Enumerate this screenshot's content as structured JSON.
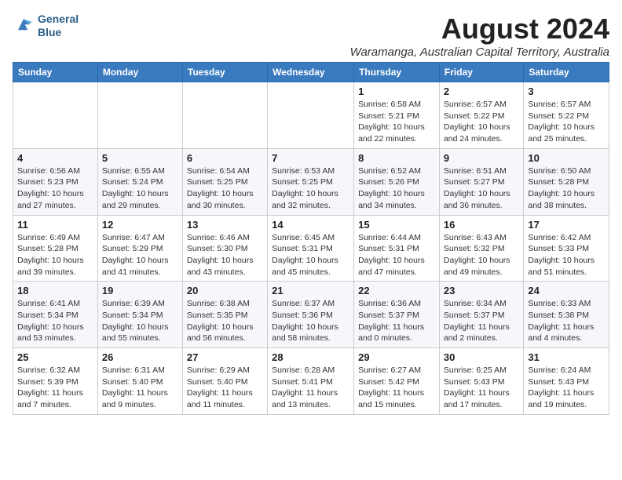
{
  "logo": {
    "line1": "General",
    "line2": "Blue"
  },
  "title": "August 2024",
  "subtitle": "Waramanga, Australian Capital Territory, Australia",
  "header_days": [
    "Sunday",
    "Monday",
    "Tuesday",
    "Wednesday",
    "Thursday",
    "Friday",
    "Saturday"
  ],
  "weeks": [
    [
      {
        "day": "",
        "info": ""
      },
      {
        "day": "",
        "info": ""
      },
      {
        "day": "",
        "info": ""
      },
      {
        "day": "",
        "info": ""
      },
      {
        "day": "1",
        "info": "Sunrise: 6:58 AM\nSunset: 5:21 PM\nDaylight: 10 hours\nand 22 minutes."
      },
      {
        "day": "2",
        "info": "Sunrise: 6:57 AM\nSunset: 5:22 PM\nDaylight: 10 hours\nand 24 minutes."
      },
      {
        "day": "3",
        "info": "Sunrise: 6:57 AM\nSunset: 5:22 PM\nDaylight: 10 hours\nand 25 minutes."
      }
    ],
    [
      {
        "day": "4",
        "info": "Sunrise: 6:56 AM\nSunset: 5:23 PM\nDaylight: 10 hours\nand 27 minutes."
      },
      {
        "day": "5",
        "info": "Sunrise: 6:55 AM\nSunset: 5:24 PM\nDaylight: 10 hours\nand 29 minutes."
      },
      {
        "day": "6",
        "info": "Sunrise: 6:54 AM\nSunset: 5:25 PM\nDaylight: 10 hours\nand 30 minutes."
      },
      {
        "day": "7",
        "info": "Sunrise: 6:53 AM\nSunset: 5:25 PM\nDaylight: 10 hours\nand 32 minutes."
      },
      {
        "day": "8",
        "info": "Sunrise: 6:52 AM\nSunset: 5:26 PM\nDaylight: 10 hours\nand 34 minutes."
      },
      {
        "day": "9",
        "info": "Sunrise: 6:51 AM\nSunset: 5:27 PM\nDaylight: 10 hours\nand 36 minutes."
      },
      {
        "day": "10",
        "info": "Sunrise: 6:50 AM\nSunset: 5:28 PM\nDaylight: 10 hours\nand 38 minutes."
      }
    ],
    [
      {
        "day": "11",
        "info": "Sunrise: 6:49 AM\nSunset: 5:28 PM\nDaylight: 10 hours\nand 39 minutes."
      },
      {
        "day": "12",
        "info": "Sunrise: 6:47 AM\nSunset: 5:29 PM\nDaylight: 10 hours\nand 41 minutes."
      },
      {
        "day": "13",
        "info": "Sunrise: 6:46 AM\nSunset: 5:30 PM\nDaylight: 10 hours\nand 43 minutes."
      },
      {
        "day": "14",
        "info": "Sunrise: 6:45 AM\nSunset: 5:31 PM\nDaylight: 10 hours\nand 45 minutes."
      },
      {
        "day": "15",
        "info": "Sunrise: 6:44 AM\nSunset: 5:31 PM\nDaylight: 10 hours\nand 47 minutes."
      },
      {
        "day": "16",
        "info": "Sunrise: 6:43 AM\nSunset: 5:32 PM\nDaylight: 10 hours\nand 49 minutes."
      },
      {
        "day": "17",
        "info": "Sunrise: 6:42 AM\nSunset: 5:33 PM\nDaylight: 10 hours\nand 51 minutes."
      }
    ],
    [
      {
        "day": "18",
        "info": "Sunrise: 6:41 AM\nSunset: 5:34 PM\nDaylight: 10 hours\nand 53 minutes."
      },
      {
        "day": "19",
        "info": "Sunrise: 6:39 AM\nSunset: 5:34 PM\nDaylight: 10 hours\nand 55 minutes."
      },
      {
        "day": "20",
        "info": "Sunrise: 6:38 AM\nSunset: 5:35 PM\nDaylight: 10 hours\nand 56 minutes."
      },
      {
        "day": "21",
        "info": "Sunrise: 6:37 AM\nSunset: 5:36 PM\nDaylight: 10 hours\nand 58 minutes."
      },
      {
        "day": "22",
        "info": "Sunrise: 6:36 AM\nSunset: 5:37 PM\nDaylight: 11 hours\nand 0 minutes."
      },
      {
        "day": "23",
        "info": "Sunrise: 6:34 AM\nSunset: 5:37 PM\nDaylight: 11 hours\nand 2 minutes."
      },
      {
        "day": "24",
        "info": "Sunrise: 6:33 AM\nSunset: 5:38 PM\nDaylight: 11 hours\nand 4 minutes."
      }
    ],
    [
      {
        "day": "25",
        "info": "Sunrise: 6:32 AM\nSunset: 5:39 PM\nDaylight: 11 hours\nand 7 minutes."
      },
      {
        "day": "26",
        "info": "Sunrise: 6:31 AM\nSunset: 5:40 PM\nDaylight: 11 hours\nand 9 minutes."
      },
      {
        "day": "27",
        "info": "Sunrise: 6:29 AM\nSunset: 5:40 PM\nDaylight: 11 hours\nand 11 minutes."
      },
      {
        "day": "28",
        "info": "Sunrise: 6:28 AM\nSunset: 5:41 PM\nDaylight: 11 hours\nand 13 minutes."
      },
      {
        "day": "29",
        "info": "Sunrise: 6:27 AM\nSunset: 5:42 PM\nDaylight: 11 hours\nand 15 minutes."
      },
      {
        "day": "30",
        "info": "Sunrise: 6:25 AM\nSunset: 5:43 PM\nDaylight: 11 hours\nand 17 minutes."
      },
      {
        "day": "31",
        "info": "Sunrise: 6:24 AM\nSunset: 5:43 PM\nDaylight: 11 hours\nand 19 minutes."
      }
    ]
  ]
}
